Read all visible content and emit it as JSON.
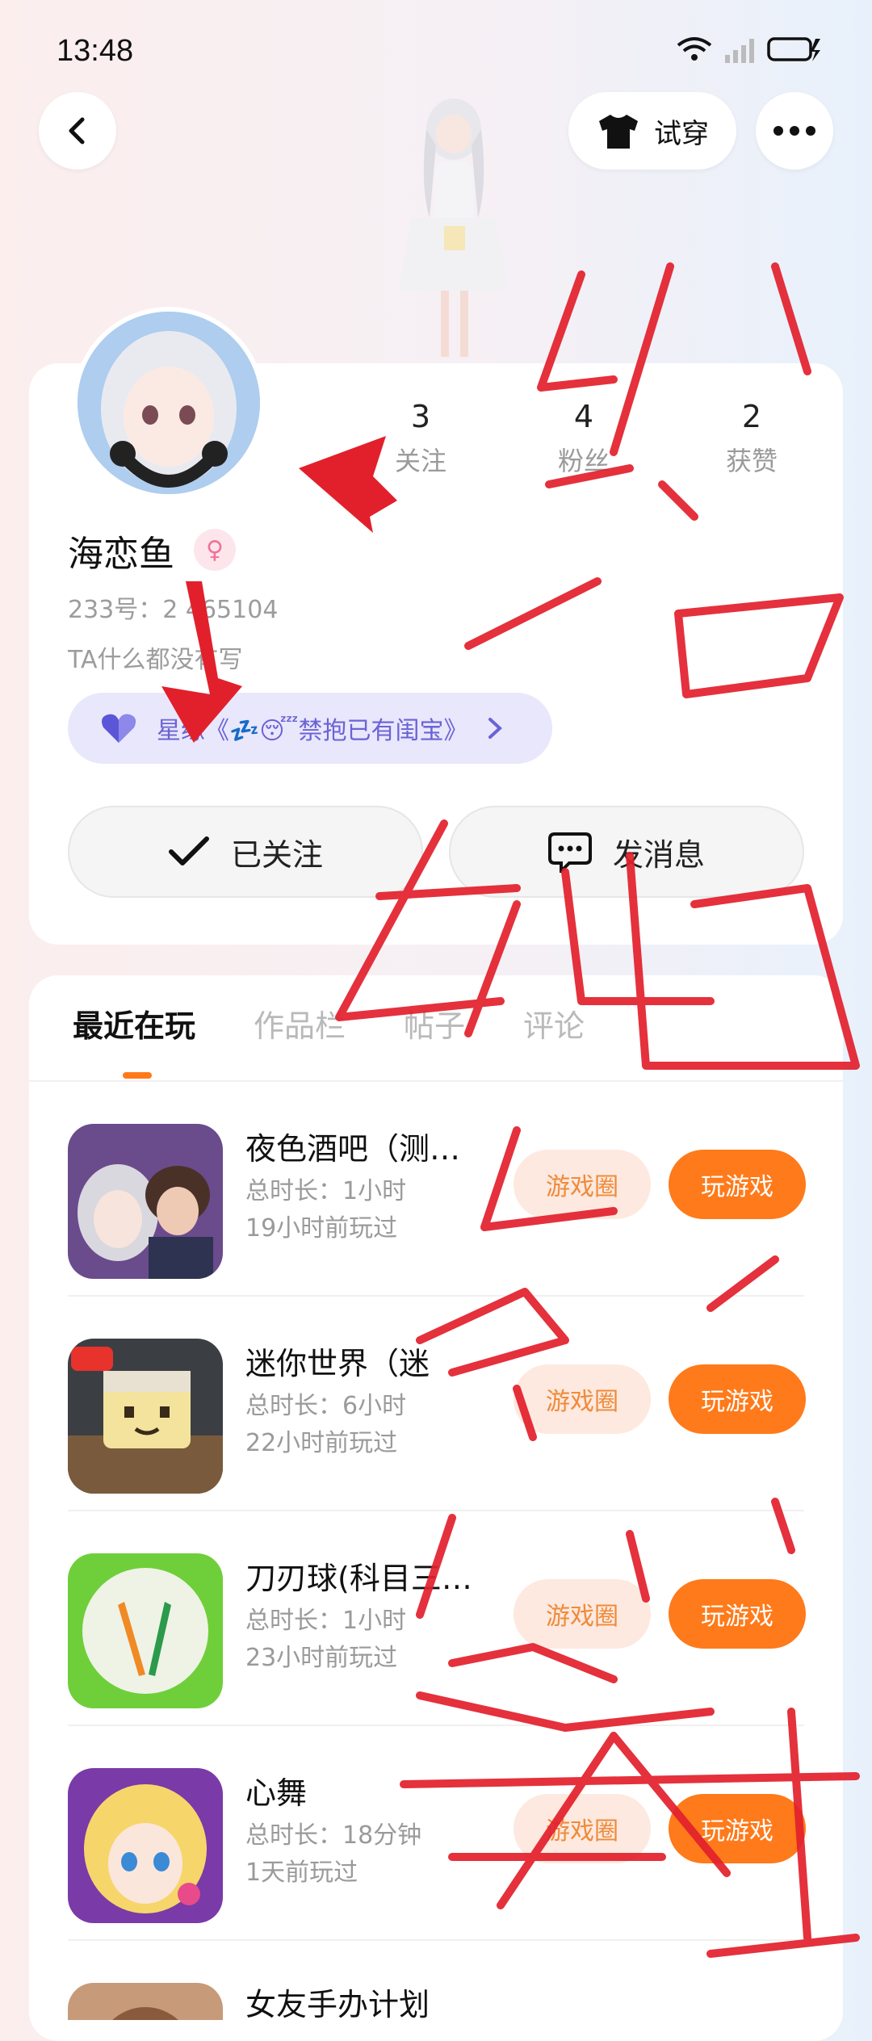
{
  "status": {
    "time": "13:48"
  },
  "header": {
    "try_on_label": "试穿"
  },
  "profile": {
    "stats": [
      {
        "value": "3",
        "label": "关注"
      },
      {
        "value": "4",
        "label": "粉丝"
      },
      {
        "value": "2",
        "label": "获赞"
      }
    ],
    "name": "海恋鱼",
    "gender_symbol": "♀",
    "id_line": "233号：2  465104",
    "bio": "TA什么都没有写",
    "star_bond": "星缘《💤😴禁抱已有闺宝》",
    "followed_label": "已关注",
    "message_label": "发消息"
  },
  "tabs": [
    {
      "label": "最近在玩"
    },
    {
      "label": "作品栏"
    },
    {
      "label": "帖子"
    },
    {
      "label": "评论"
    }
  ],
  "games": [
    {
      "title": "夜色酒吧（测…",
      "duration": "总时长：1小时",
      "last_played": "19小时前玩过",
      "circle_label": "游戏圈",
      "play_label": "玩游戏"
    },
    {
      "title": "迷你世界（迷",
      "duration": "总时长：6小时",
      "last_played": "22小时前玩过",
      "circle_label": "游戏圈",
      "play_label": "玩游戏"
    },
    {
      "title": "刀刃球(科目三…",
      "duration": "总时长：1小时",
      "last_played": "23小时前玩过",
      "circle_label": "游戏圈",
      "play_label": "玩游戏"
    },
    {
      "title": "心舞",
      "duration": "总时长：18分钟",
      "last_played": "1天前玩过",
      "circle_label": "游戏圈",
      "play_label": "玩游戏"
    },
    {
      "title": "女友手办计划",
      "duration": "",
      "last_played": "",
      "circle_label": "",
      "play_label": ""
    }
  ],
  "colors": {
    "accent": "#ff7a1a",
    "annotation": "#e2202c",
    "star_pill": "#e9e7fb"
  }
}
